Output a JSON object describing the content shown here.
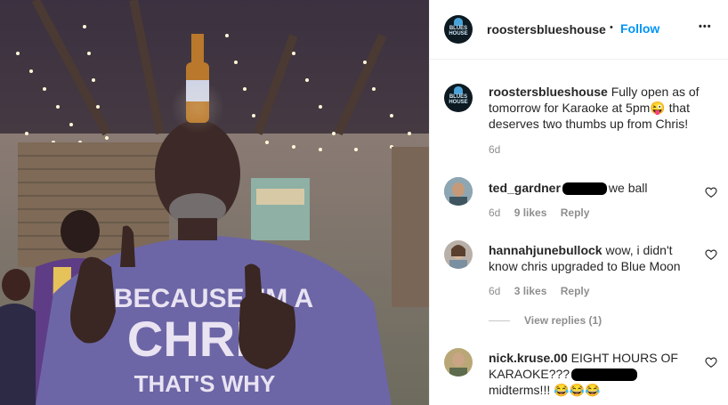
{
  "post": {
    "username": "roostersblueshouse",
    "follow_label": "Follow",
    "separator": "•",
    "more_label": "•••",
    "caption_text": "Fully open as of tomorrow for Karaoke at 5pm😜 that deserves two thumbs up from Chris!",
    "caption_time": "6d",
    "avatar_text": "BLUES HOUSE",
    "photo_shirt_text_1": "BECAUSE I'M A",
    "photo_shirt_text_2": "CHRIS",
    "photo_shirt_text_3": "THAT'S WHY"
  },
  "comments": [
    {
      "username": "ted_gardner",
      "text": "we ball",
      "time": "6d",
      "likes": "9 likes",
      "reply": "Reply"
    },
    {
      "username": "hannahjunebullock",
      "text": "wow, i didn't know chris upgraded to Blue Moon",
      "time": "6d",
      "likes": "3 likes",
      "reply": "Reply"
    },
    {
      "username": "nick.kruse.00",
      "text": "EIGHT HOURS OF KARAOKE???",
      "text_after": "midterms!!! 😂😂😂"
    }
  ],
  "view_replies_label": "View replies (1)",
  "colors": {
    "link": "#0095f6",
    "text": "#262626",
    "muted": "#8e8e8e"
  }
}
